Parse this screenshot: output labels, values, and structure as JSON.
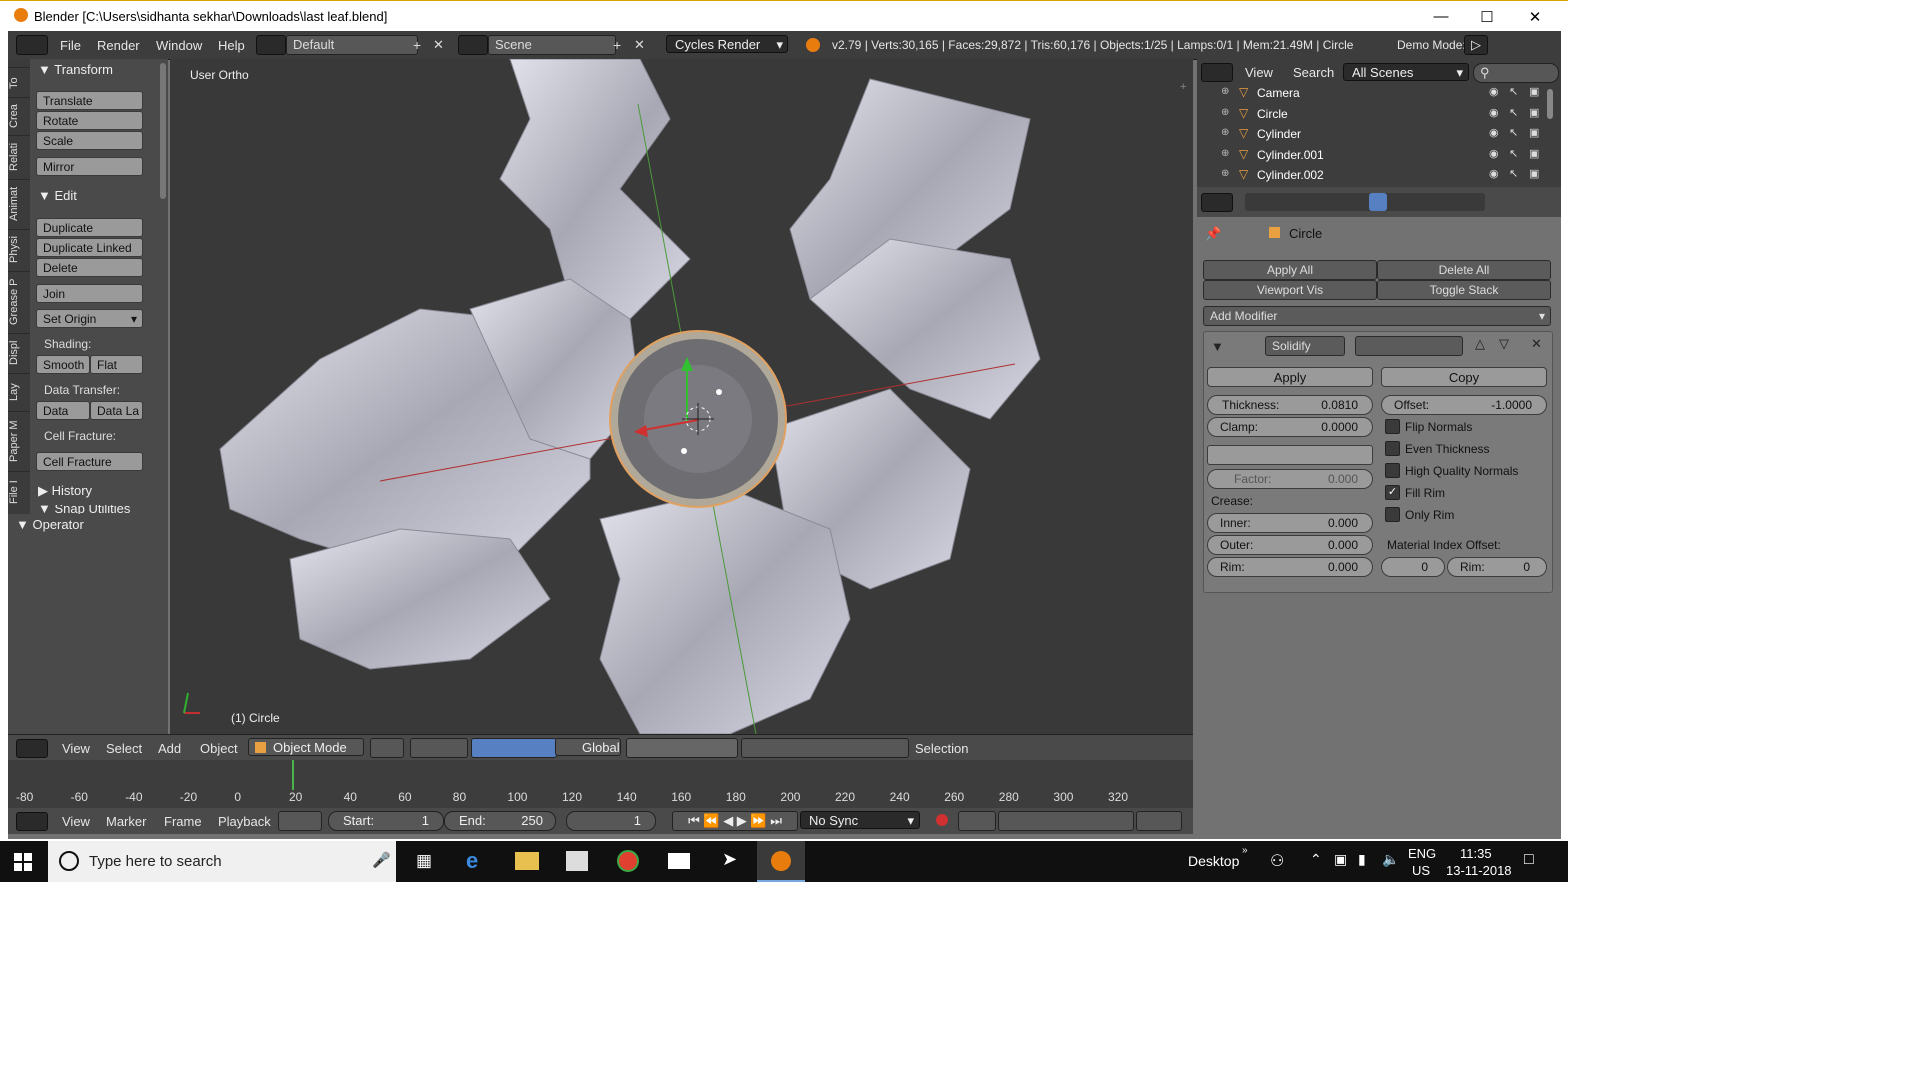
{
  "window": {
    "title": "Blender [C:\\Users\\sidhanta sekhar\\Downloads\\last leaf.blend]"
  },
  "topbar": {
    "menus": [
      "File",
      "Render",
      "Window",
      "Help"
    ],
    "layout": "Default",
    "scene": "Scene",
    "engine": "Cycles Render",
    "stats": "v2.79 | Verts:30,165 | Faces:29,872 | Tris:60,176 | Objects:1/25 | Lamps:0/1 | Mem:21.49M | Circle",
    "demo_mode": "Demo Mode:"
  },
  "tabs": [
    "To",
    "Crea",
    "Relati",
    "Animat",
    "Physi",
    "Grease P",
    "Displ",
    "Lay",
    "Paper M",
    "File I"
  ],
  "toolshelf": {
    "transform_title": "Transform",
    "translate": "Translate",
    "rotate": "Rotate",
    "scale": "Scale",
    "mirror": "Mirror",
    "edit_title": "Edit",
    "duplicate": "Duplicate",
    "duplicate_linked": "Duplicate Linked",
    "delete": "Delete",
    "join": "Join",
    "set_origin": "Set Origin",
    "shading_label": "Shading:",
    "smooth": "Smooth",
    "flat": "Flat",
    "data_transfer_label": "Data Transfer:",
    "data": "Data",
    "data_la": "Data La",
    "cell_fracture_label": "Cell Fracture:",
    "cell_fracture": "Cell Fracture",
    "history": "History",
    "snap_utilities": "Snap Utilities",
    "operator": "Operator"
  },
  "viewport": {
    "view_label": "User Ortho",
    "object_label": "(1) Circle"
  },
  "view_header": {
    "menus": [
      "View",
      "Select",
      "Add",
      "Object"
    ],
    "mode": "Object Mode",
    "orientation": "Global",
    "selection_label": "Selection"
  },
  "timeline": {
    "ticks": [
      "-80",
      "-60",
      "-40",
      "-20",
      "0",
      "20",
      "40",
      "60",
      "80",
      "100",
      "120",
      "140",
      "160",
      "180",
      "200",
      "220",
      "240",
      "260",
      "280",
      "300",
      "320"
    ],
    "menus": [
      "View",
      "Marker",
      "Frame",
      "Playback"
    ],
    "start": "Start:",
    "start_val": "1",
    "end": "End:",
    "end_val": "250",
    "current": "1",
    "sync": "No Sync"
  },
  "outliner": {
    "menus": [
      "View",
      "Search"
    ],
    "filter": "All Scenes",
    "items": [
      "Camera",
      "Circle",
      "Cylinder",
      "Cylinder.001",
      "Cylinder.002"
    ]
  },
  "properties": {
    "object_name": "Circle",
    "apply_all": "Apply All",
    "delete_all": "Delete All",
    "viewport_vis": "Viewport Vis",
    "toggle_stack": "Toggle Stack",
    "add_modifier": "Add Modifier",
    "modifier_name": "Solidify",
    "apply": "Apply",
    "copy": "Copy",
    "thickness_label": "Thickness:",
    "thickness_val": "0.0810",
    "offset_label": "Offset:",
    "offset_val": "-1.0000",
    "clamp_label": "Clamp:",
    "clamp_val": "0.0000",
    "factor_label": "Factor:",
    "factor_val": "0.000",
    "crease_label": "Crease:",
    "inner_label": "Inner:",
    "inner_val": "0.000",
    "outer_label": "Outer:",
    "outer_val": "0.000",
    "rim_label": "Rim:",
    "rim_val": "0.000",
    "flip_normals": "Flip Normals",
    "even_thickness": "Even Thickness",
    "high_quality_normals": "High Quality Normals",
    "fill_rim": "Fill Rim",
    "only_rim": "Only Rim",
    "material_index_offset": "Material Index Offset:",
    "mat_val": "0",
    "mat_rim_label": "Rim:",
    "mat_rim_val": "0"
  },
  "taskbar": {
    "search_placeholder": "Type here to search",
    "desktop": "Desktop",
    "lang": "ENG",
    "region": "US",
    "time": "11:35",
    "date": "13-11-2018"
  }
}
